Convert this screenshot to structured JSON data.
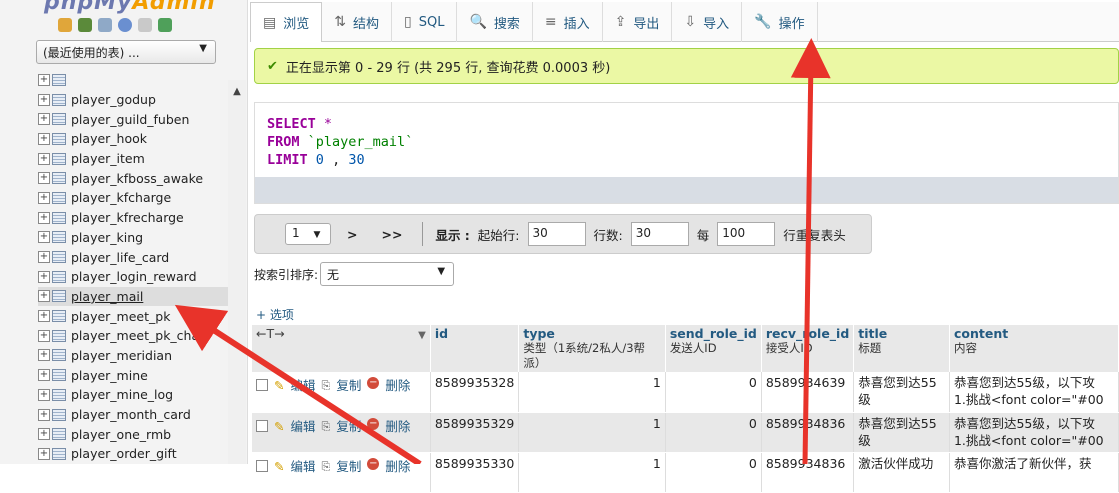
{
  "app": {
    "logo_main": "phpMy",
    "logo_accent": "Admin"
  },
  "sidebar": {
    "db_select": "(最近使用的表) ...",
    "tables": [
      "player_godup",
      "player_guild_fuben",
      "player_hook",
      "player_item",
      "player_kfboss_awake",
      "player_kfcharge",
      "player_kfrecharge",
      "player_king",
      "player_life_card",
      "player_login_reward",
      "player_mail",
      "player_meet_pk",
      "player_meet_pk_chals",
      "player_meridian",
      "player_mine",
      "player_mine_log",
      "player_month_card",
      "player_one_rmb",
      "player_order_gift"
    ],
    "active_index": 10
  },
  "tabs": [
    {
      "label": "浏览",
      "icon": "browse-icon"
    },
    {
      "label": "结构",
      "icon": "structure-icon"
    },
    {
      "label": "SQL",
      "icon": "sql-icon"
    },
    {
      "label": "搜索",
      "icon": "search-icon"
    },
    {
      "label": "插入",
      "icon": "insert-icon"
    },
    {
      "label": "导出",
      "icon": "export-icon"
    },
    {
      "label": "导入",
      "icon": "import-icon"
    },
    {
      "label": "操作",
      "icon": "wrench-icon"
    }
  ],
  "message": "正在显示第 0 - 29 行 (共 295 行, 查询花费 0.0003 秒)",
  "sql": {
    "select": "SELECT",
    "star": "*",
    "from": "FROM",
    "table": "`player_mail`",
    "limit": "LIMIT",
    "offset": "0",
    "comma": ",",
    "count": "30"
  },
  "nav": {
    "page": "1",
    "next": ">",
    "last": ">>",
    "show_label": "显示 :",
    "start_label": "起始行:",
    "start_value": "30",
    "rows_label": "行数:",
    "rows_value": "30",
    "every_label": "每",
    "every_value": "100",
    "repeat_label": "行重复表头"
  },
  "sort": {
    "label": "按索引排序:",
    "value": "无"
  },
  "options_label": "+ 选项",
  "table": {
    "columns": [
      {
        "name": "id",
        "sub": ""
      },
      {
        "name": "type",
        "sub": "类型（1系统/2私人/3帮派）"
      },
      {
        "name": "send_role_id",
        "sub": "发送人ID"
      },
      {
        "name": "recv_role_id",
        "sub": "接受人ID"
      },
      {
        "name": "title",
        "sub": "标题"
      },
      {
        "name": "content",
        "sub": "内容"
      }
    ],
    "action_labels": {
      "edit": "编辑",
      "copy": "复制",
      "delete": "删除"
    },
    "rows": [
      {
        "id": "8589935328",
        "type": "1",
        "send": "0",
        "recv": "8589934639",
        "title": "恭喜您到达55级",
        "content1": "恭喜您到达55级，以下攻",
        "content2": "1.挑战<font color=\"#00"
      },
      {
        "id": "8589935329",
        "type": "1",
        "send": "0",
        "recv": "8589934836",
        "title": "恭喜您到达55级",
        "content1": "恭喜您到达55级，以下攻",
        "content2": "1.挑战<font color=\"#00"
      },
      {
        "id": "8589935330",
        "type": "1",
        "send": "0",
        "recv": "8589934836",
        "title": "激活伙伴成功",
        "content1": "恭喜你激活了新伙伴，获",
        "content2": ""
      }
    ]
  }
}
